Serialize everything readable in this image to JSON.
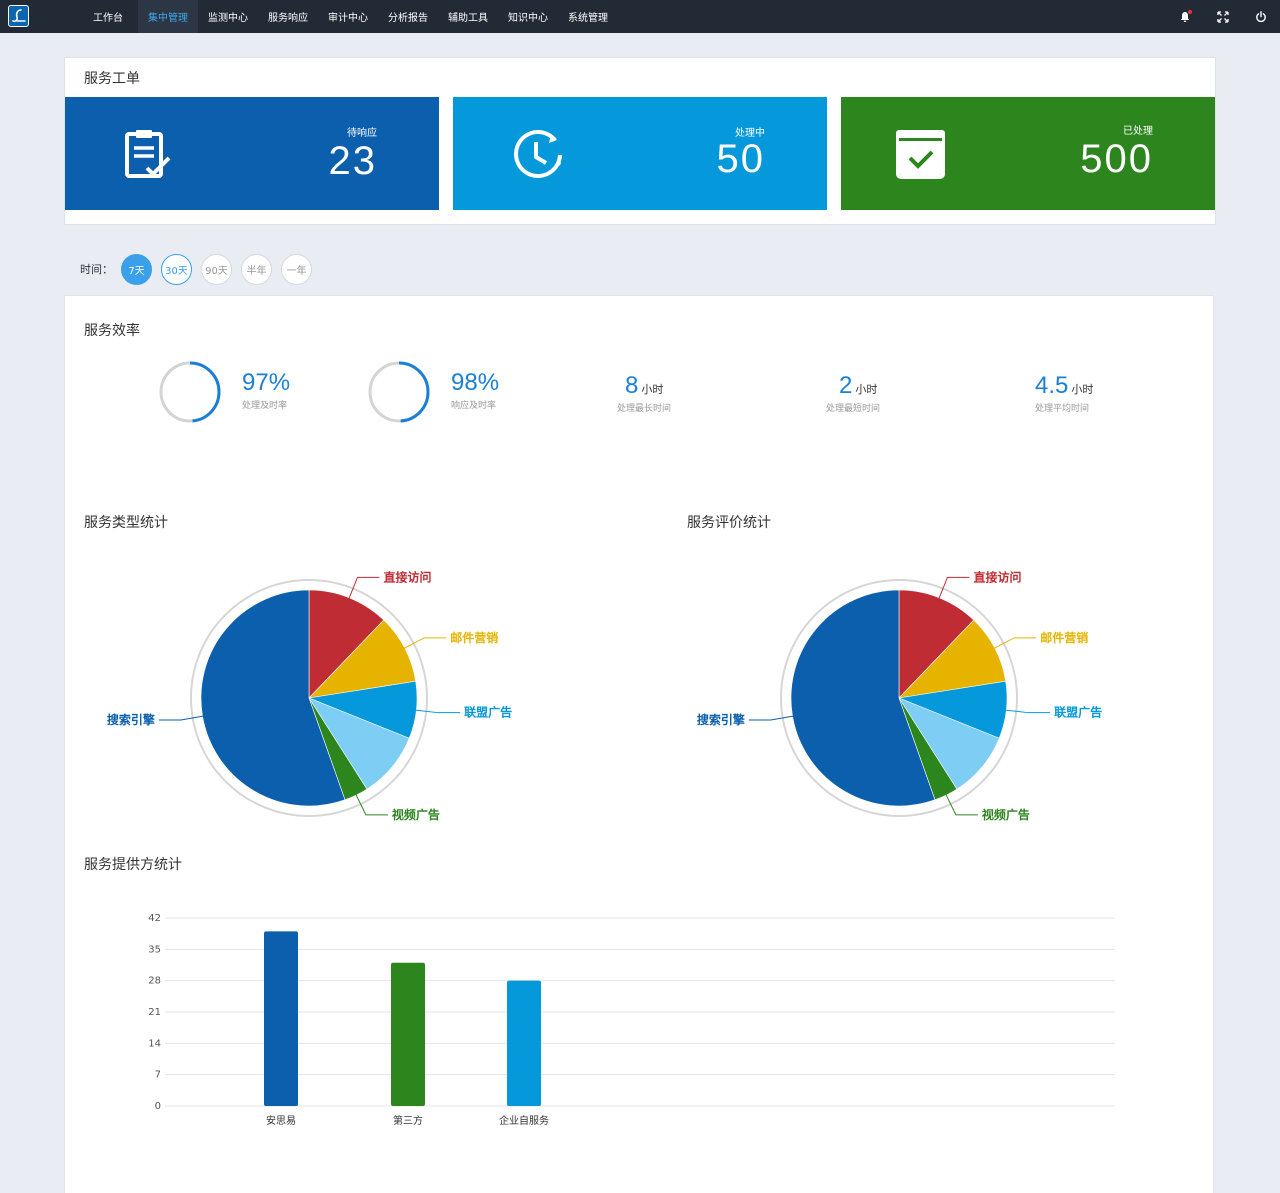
{
  "nav": {
    "items": [
      {
        "label": "工作台",
        "active": false
      },
      {
        "label": "集中管理",
        "active": true
      },
      {
        "label": "监测中心",
        "active": false
      },
      {
        "label": "服务响应",
        "active": false
      },
      {
        "label": "审计中心",
        "active": false
      },
      {
        "label": "分析报告",
        "active": false
      },
      {
        "label": "辅助工具",
        "active": false
      },
      {
        "label": "知识中心",
        "active": false
      },
      {
        "label": "系统管理",
        "active": false
      }
    ],
    "icons": [
      "bell-icon",
      "fullscreen-icon",
      "power-icon"
    ]
  },
  "tickets": {
    "title": "服务工单",
    "cards": [
      {
        "label": "待响应",
        "value": "23",
        "color": "#0c5fac",
        "icon": "clipboard-icon"
      },
      {
        "label": "处理中",
        "value": "50",
        "color": "#0598da",
        "icon": "clock-icon"
      },
      {
        "label": "已处理",
        "value": "500",
        "color": "#2c861d",
        "icon": "check-box-icon"
      }
    ]
  },
  "time_filter": {
    "label": "时间：",
    "options": [
      "7天",
      "30天",
      "90天",
      "半年",
      "一年"
    ],
    "selected": "7天"
  },
  "efficiency": {
    "title": "服务效率",
    "rate_kpis": [
      {
        "value": "97%",
        "label": "处理及时率",
        "fraction": 0.97
      },
      {
        "value": "98%",
        "label": "响应及时率",
        "fraction": 0.98
      }
    ],
    "time_kpis": [
      {
        "value": "8",
        "unit": "小时",
        "label": "处理最长时间"
      },
      {
        "value": "2",
        "unit": "小时",
        "label": "处理最短时间"
      },
      {
        "value": "4.5",
        "unit": "小时",
        "label": "处理平均时间"
      }
    ]
  },
  "type_stats": {
    "title": "服务类型统计"
  },
  "rating_stats": {
    "title": "服务评价统计"
  },
  "provider_stats": {
    "title": "服务提供方统计"
  },
  "colors": {
    "nav_bg": "#222a35",
    "accent": "#3aa0ea",
    "dark_blue": "#0c5fac",
    "light_blue": "#0598da",
    "green": "#2c861d",
    "red": "#c02c33",
    "yellow": "#e6b400",
    "sky": "#7ecdf4"
  },
  "chart_data": [
    {
      "type": "pie",
      "title": "服务类型统计",
      "categories": [
        "直接访问",
        "邮件营销",
        "联盟广告",
        "视频广告",
        "搜索引擎"
      ],
      "values": [
        13.5,
        11.5,
        9.5,
        4.0,
        61.5
      ],
      "colors": [
        "#c02c33",
        "#e6b400",
        "#0598da",
        "#2c861d",
        "#0c5fac"
      ],
      "inner_segment": {
        "after": "联盟广告",
        "value": 11.0,
        "color": "#7ecdf4"
      }
    },
    {
      "type": "pie",
      "title": "服务评价统计",
      "categories": [
        "直接访问",
        "邮件营销",
        "联盟广告",
        "视频广告",
        "搜索引擎"
      ],
      "values": [
        13.5,
        11.5,
        9.5,
        4.0,
        61.5
      ],
      "colors": [
        "#c02c33",
        "#e6b400",
        "#0598da",
        "#2c861d",
        "#0c5fac"
      ],
      "inner_segment": {
        "after": "联盟广告",
        "value": 11.0,
        "color": "#7ecdf4"
      }
    },
    {
      "type": "bar",
      "title": "服务提供方统计",
      "categories": [
        "安思易",
        "第三方",
        "企业自服务"
      ],
      "values": [
        39,
        32,
        28
      ],
      "colors": [
        "#0c5fac",
        "#2c861d",
        "#0598da"
      ],
      "yticks": [
        0,
        7,
        14,
        21,
        28,
        35,
        42
      ],
      "ylim": [
        0,
        42
      ],
      "grid": true
    }
  ]
}
